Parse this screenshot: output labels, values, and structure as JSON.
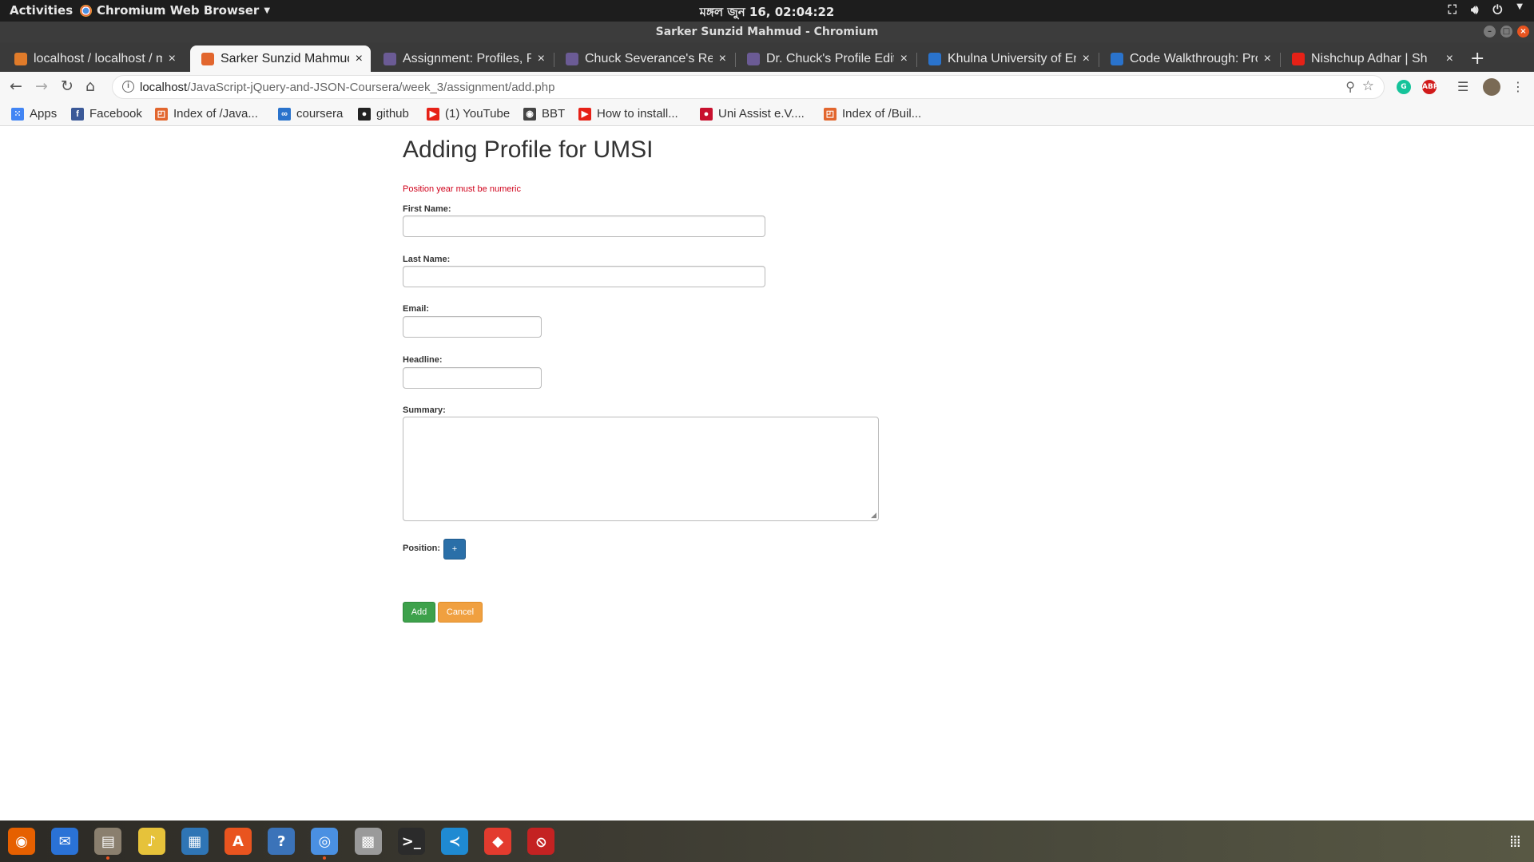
{
  "topbar": {
    "activities": "Activities",
    "app_menu": "Chromium Web Browser",
    "clock": "মঙ্গল জুন 16, 02:04:22"
  },
  "window": {
    "title": "Sarker Sunzid Mahmud - Chromium"
  },
  "tabs": [
    {
      "label": "localhost / localhost / m",
      "icon": "phpmyadmin-icon",
      "color": "#e07b2a",
      "active": false
    },
    {
      "label": "Sarker Sunzid Mahmud",
      "icon": "html-icon",
      "color": "#e2662e",
      "active": true
    },
    {
      "label": "Assignment: Profiles, Po",
      "icon": "profile-icon",
      "color": "#6b5b95",
      "active": false
    },
    {
      "label": "Chuck Severance's Resu",
      "icon": "profile-icon",
      "color": "#6b5b95",
      "active": false
    },
    {
      "label": "Dr. Chuck's Profile Edit",
      "icon": "profile-icon",
      "color": "#6b5b95",
      "active": false
    },
    {
      "label": "Khulna University of Eng",
      "icon": "coursera-icon",
      "color": "#2a73cc",
      "active": false
    },
    {
      "label": "Code Walkthrough: Pro",
      "icon": "coursera-icon",
      "color": "#2a73cc",
      "active": false
    },
    {
      "label": "Nishchup Adhar | Sh",
      "icon": "youtube-icon",
      "color": "#e62117",
      "active": false
    }
  ],
  "toolbar": {
    "url_host": "localhost",
    "url_path": "/JavaScript-jQuery-and-JSON-Coursera/week_3/assignment/add.php"
  },
  "bookmarks": [
    {
      "label": "Apps",
      "icon": "apps-grid-icon",
      "color": "#4285f4"
    },
    {
      "label": "Facebook",
      "icon": "facebook-icon",
      "color": "#3b5998"
    },
    {
      "label": "Index of /Java...",
      "icon": "html-icon",
      "color": "#e2662e"
    },
    {
      "label": "coursera",
      "icon": "coursera-icon",
      "color": "#2a73cc"
    },
    {
      "label": "github",
      "icon": "github-icon",
      "color": "#222222"
    },
    {
      "label": "(1) YouTube",
      "icon": "youtube-icon",
      "color": "#e62117"
    },
    {
      "label": "BBT",
      "icon": "globe-icon",
      "color": "#444444"
    },
    {
      "label": "How to install...",
      "icon": "youtube-icon",
      "color": "#e62117"
    },
    {
      "label": "Uni Assist e.V....",
      "icon": "uni-assist-icon",
      "color": "#c8102e"
    },
    {
      "label": "Index of /Buil...",
      "icon": "html-icon",
      "color": "#e2662e"
    }
  ],
  "page": {
    "title": "Adding Profile for UMSI",
    "error": "Position year must be numeric",
    "labels": {
      "first_name": "First Name:",
      "last_name": "Last Name:",
      "email": "Email:",
      "headline": "Headline:",
      "summary": "Summary:",
      "position": "Position:"
    },
    "values": {
      "first_name": "",
      "last_name": "",
      "email": "",
      "headline": "",
      "summary": ""
    },
    "buttons": {
      "add_position": "+",
      "add": "Add",
      "cancel": "Cancel"
    }
  },
  "dock": [
    {
      "name": "firefox-icon",
      "color": "#e66000",
      "running": false
    },
    {
      "name": "thunderbird-icon",
      "color": "#2a72d6",
      "running": false
    },
    {
      "name": "files-icon",
      "color": "#8a7f6e",
      "running": true
    },
    {
      "name": "rhythmbox-icon",
      "color": "#e6c23a",
      "running": false
    },
    {
      "name": "writer-icon",
      "color": "#2f75b5",
      "running": false
    },
    {
      "name": "software-center-icon",
      "color": "#e9541f",
      "running": false
    },
    {
      "name": "help-icon",
      "color": "#3b73b9",
      "running": false
    },
    {
      "name": "chromium-icon",
      "color": "#4a90e2",
      "running": true
    },
    {
      "name": "launcher-icon",
      "color": "#9a9a9a",
      "running": false
    },
    {
      "name": "terminal-icon",
      "color": "#2b2b2b",
      "running": false
    },
    {
      "name": "vscode-icon",
      "color": "#1f8ad2",
      "running": false
    },
    {
      "name": "git-icon",
      "color": "#e33b2e",
      "running": false
    },
    {
      "name": "screen-recorder-icon",
      "color": "#c42222",
      "running": false
    }
  ]
}
